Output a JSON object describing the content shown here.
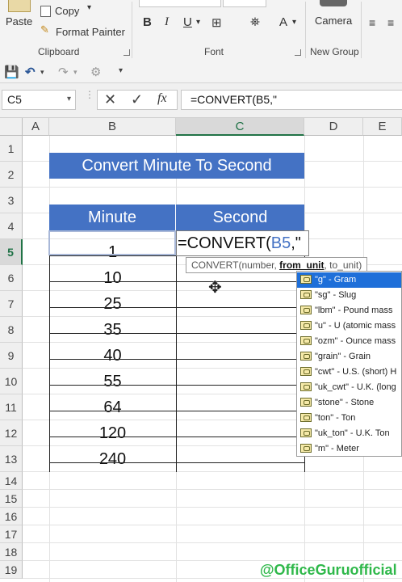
{
  "ribbon": {
    "paste_label": "Paste",
    "copy_label": "Copy",
    "format_painter_label": "Format Painter",
    "clipboard_label": "Clipboard",
    "font_label": "Font",
    "camera_label": "Camera",
    "new_group_label": "New Group",
    "bold_label": "B",
    "italic_label": "I",
    "underline_label": "U",
    "font_color_label": "A"
  },
  "formula_bar": {
    "name_box": "C5",
    "fx_label": "fx",
    "formula": "=CONVERT(B5,\""
  },
  "columns": [
    "A",
    "B",
    "C",
    "D",
    "E"
  ],
  "rows": [
    "1",
    "2",
    "3",
    "4",
    "5",
    "6",
    "7",
    "8",
    "9",
    "10",
    "11",
    "12",
    "13",
    "14",
    "15",
    "16",
    "17",
    "18",
    "19"
  ],
  "sheet": {
    "title": "Convert Minute To Second",
    "header_minute": "Minute",
    "header_second": "Second",
    "minutes": [
      "1",
      "10",
      "25",
      "35",
      "40",
      "55",
      "64",
      "120",
      "240"
    ],
    "edit_prefix": "=CONVERT(",
    "edit_ref": "B5",
    "edit_suffix": ",\""
  },
  "tooltip": {
    "func": "CONVERT(number, ",
    "bold_arg": "from_unit",
    "rest": ", to_unit)"
  },
  "autocomplete": [
    "\"g\" - Gram",
    "\"sg\" - Slug",
    "\"lbm\" - Pound mass",
    "\"u\" - U (atomic mass",
    "\"ozm\" - Ounce mass",
    "\"grain\" - Grain",
    "\"cwt\" - U.S. (short) H",
    "\"uk_cwt\" - U.K. (long",
    "\"stone\" - Stone",
    "\"ton\" - Ton",
    "\"uk_ton\" - U.K. Ton",
    "\"m\" - Meter"
  ],
  "watermark": "@OfficeGuruofficial",
  "colors": {
    "header_fill": "#4472c4",
    "select_green": "#217346",
    "dropdown_highlight": "#1e6fd9",
    "ref_blue": "#4472c4",
    "watermark_green": "#2fb84a"
  }
}
